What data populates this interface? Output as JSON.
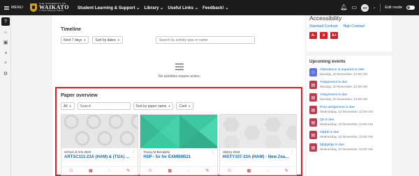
{
  "topbar": {
    "menu_label": "MENU",
    "logo_small": "THE UNIVERSITY OF",
    "logo_big": "WAIKATO",
    "logo_sub": "Te Whare Wānanga o Waikato",
    "nav_links": [
      "Student Learning & Support ⌄",
      "Library ⌄",
      "Useful Links ⌄",
      "Feedback! ⌄"
    ],
    "avatar_initials": "SS",
    "edit_mode_label": "Edit mode"
  },
  "timeline": {
    "title": "Timeline",
    "range_select": "Next 7 days",
    "sort_select": "Sort by dates",
    "search_placeholder": "Search by activity type or name",
    "empty_text": "No activities require action."
  },
  "overview": {
    "title": "Paper overview",
    "filter_select": "All",
    "search_placeholder": "Search",
    "sort_select": "Sort by paper name",
    "view_select": "Card",
    "cards": [
      {
        "category": "School of Arts 2023",
        "title": "ARTSC111-23A (HAM) & (TGA) ...",
        "image_color": "#e6e6e6"
      },
      {
        "category": "Tracey M Bendjelta",
        "title": "HSP - 5x for EXMBM521",
        "image_color": "#3ec8a0"
      },
      {
        "category": "History 2023",
        "title": "HISTY107-23A (HAM) - New Zea...",
        "image_color": "#e9e9e9"
      }
    ]
  },
  "accessibility": {
    "title": "Accessibility",
    "standard_contrast": "Standard Contrast",
    "high_contrast": "High Contrast",
    "font_buttons": [
      "A-",
      "A",
      "A+"
    ]
  },
  "events": {
    "title": "Upcoming events",
    "items": [
      {
        "name": "Attendance is required or else",
        "date": "Monday, 20 November, 12:00 AM",
        "icon": "attendance-icon"
      },
      {
        "name": "Assignment is due",
        "date": "Monday, 20 November, 12:00 AM",
        "icon": "assignment-icon"
      },
      {
        "name": "Assignment is due",
        "date": "Monday, 20 November, 12:00 AM",
        "icon": "assignment-icon"
      },
      {
        "name": "Print assignment is due",
        "date": "Wednesday, 22 November, 12:00 AM",
        "icon": "assignment-icon"
      },
      {
        "name": "Qx is due",
        "date": "Wednesday, 22 November, 12:00 AM",
        "icon": "assignment-icon"
      },
      {
        "name": "Hjkjhk is due",
        "date": "Wednesday, 22 November, 12:00 AM",
        "icon": "assignment-icon"
      },
      {
        "name": "fgfgfgsfgs is due",
        "date": "Wednesday, 22 November, 12:00 AM",
        "icon": "assignment-icon"
      }
    ]
  },
  "colors": {
    "topbar": "#1c1c1c",
    "accent_red": "#d71f25",
    "link_blue": "#0f6cbf",
    "card_green": "#3ec8a0"
  }
}
